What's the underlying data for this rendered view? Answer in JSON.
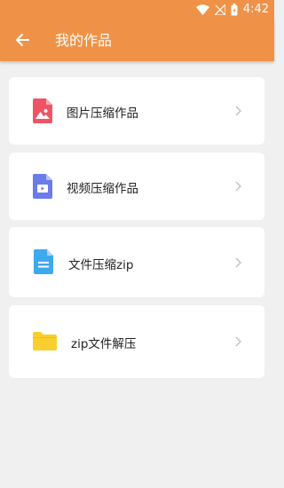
{
  "status_bar": {
    "time": "4:42",
    "icons": [
      "wifi-icon",
      "signal-icon",
      "battery-icon"
    ]
  },
  "app_bar": {
    "back_icon": "arrow-left-icon",
    "title": "我的作品"
  },
  "items": [
    {
      "label": "图片压缩作品",
      "icon": "image-file-icon",
      "icon_color": "#ef5466"
    },
    {
      "label": "视频压缩作品",
      "icon": "video-file-icon",
      "icon_color": "#6b7bea"
    },
    {
      "label": "文件压缩zip",
      "icon": "document-file-icon",
      "icon_color": "#3da9ef"
    },
    {
      "label": "zip文件解压",
      "icon": "folder-icon",
      "icon_color": "#f9cf2e"
    }
  ],
  "colors": {
    "accent": "#ef9247",
    "background": "#f0f0f0",
    "card": "#ffffff",
    "chevron": "#c2c2c2"
  }
}
